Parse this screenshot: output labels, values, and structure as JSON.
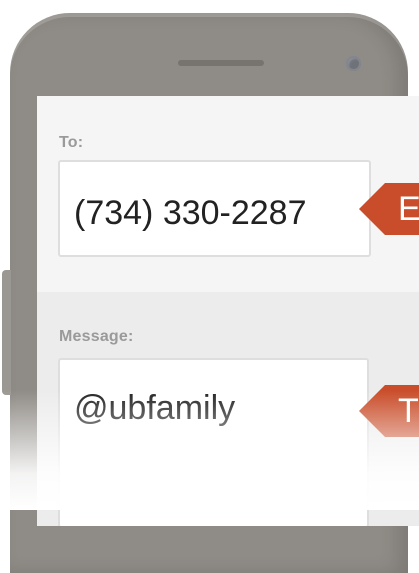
{
  "form": {
    "to_label": "To:",
    "to_value": "(734) 330-2287",
    "message_label": "Message:",
    "message_value": "@ubfamily"
  },
  "callouts": [
    {
      "text": "E"
    },
    {
      "text": "T"
    }
  ],
  "colors": {
    "phone_body": "#8f8b86",
    "screen_bg": "#f3f3f3",
    "callout": "#c94d2a",
    "label": "#9a9a9a"
  }
}
